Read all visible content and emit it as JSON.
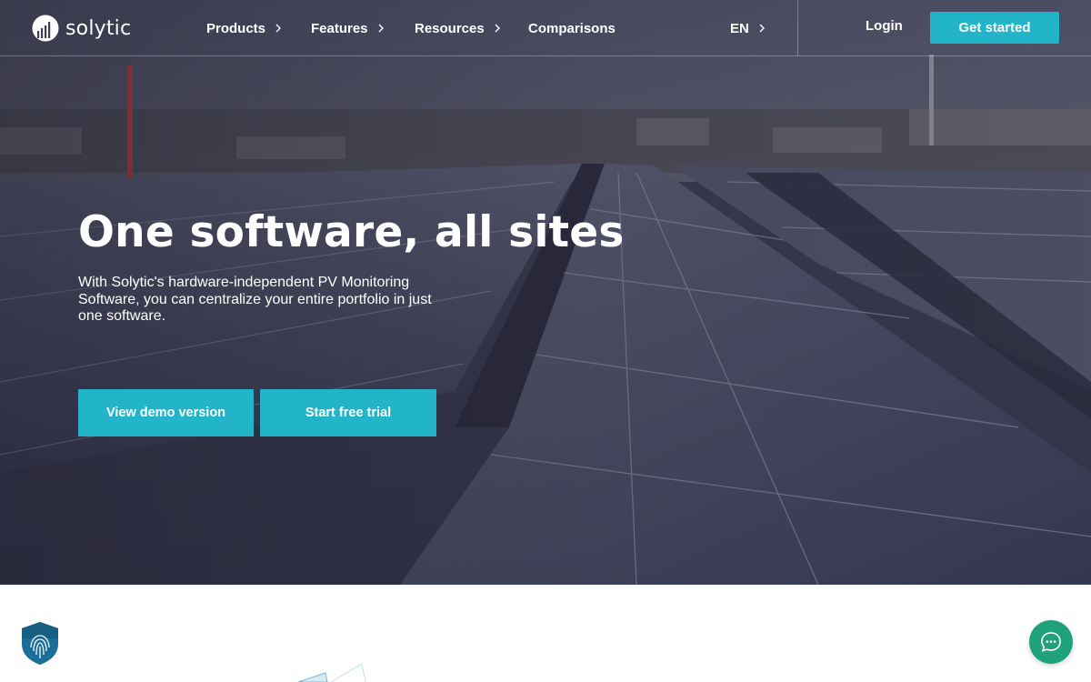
{
  "brand": {
    "name": "solytic",
    "accent": "#22b5c9",
    "chat_color": "#1fa27c"
  },
  "nav": {
    "items": [
      {
        "label": "Products",
        "has_chevron": true
      },
      {
        "label": "Features",
        "has_chevron": true
      },
      {
        "label": "Resources",
        "has_chevron": true
      },
      {
        "label": "Comparisons",
        "has_chevron": false
      }
    ],
    "language": "EN",
    "login": "Login",
    "get_started": "Get started"
  },
  "hero": {
    "headline": "One software, all sites",
    "subtext": "With Solytic's hardware-independent PV Monitoring Software, you can centralize your entire portfolio in just one software.",
    "buttons": {
      "demo": "View demo version",
      "trial": "Start free trial"
    }
  },
  "icons": {
    "logo": "solytic-logo-icon",
    "chevron": "chevron-right-icon",
    "security": "fingerprint-shield-icon",
    "chat": "chat-bubble-icon"
  }
}
